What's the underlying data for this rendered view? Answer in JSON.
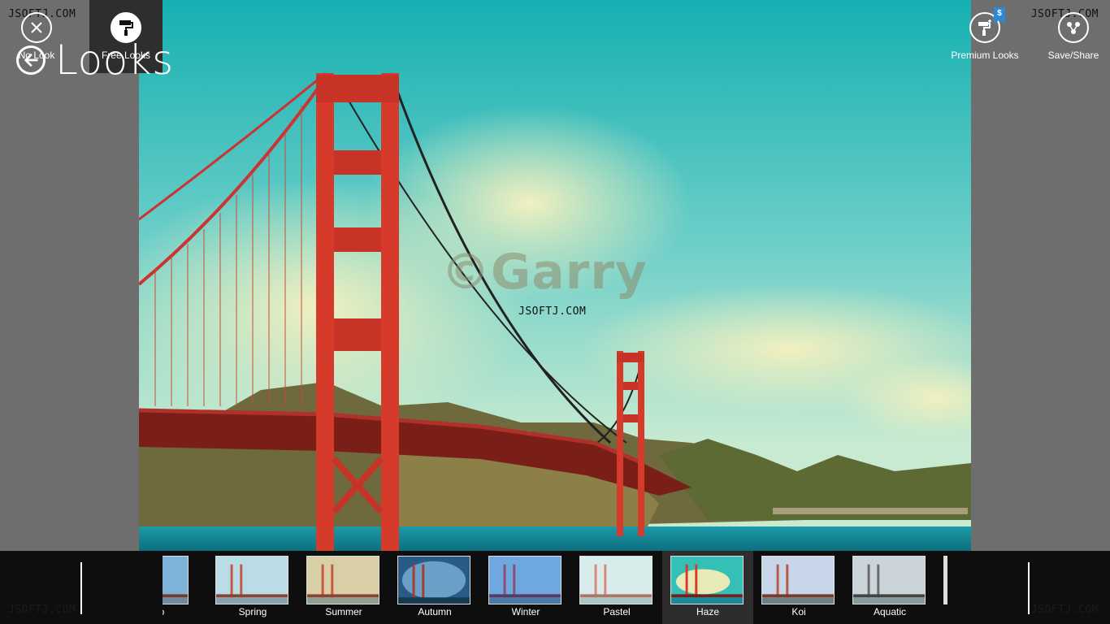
{
  "watermarks": {
    "top_left": "JSOFTJ.COM",
    "top_right": "JSOFTJ.COM",
    "center": "JSOFTJ.COM",
    "bottom_left": "JSOFTJ.COM",
    "bottom_right": "JSOFTJ.COM"
  },
  "header": {
    "title": "Looks",
    "back_icon": "back-arrow-icon"
  },
  "photo": {
    "subject": "golden-gate-bridge",
    "overlay_text": "©Garry",
    "colors": {
      "sky_top": "#18b3b3",
      "sky_bottom": "#bfe6cc",
      "bridge": "#d63a2a",
      "water": "#1a8a9a"
    }
  },
  "appbar": {
    "no_look": {
      "label": "No Look",
      "icon": "close-circle-icon"
    },
    "free_looks": {
      "label": "Free Looks",
      "icon": "paint-roller-icon"
    },
    "premium_looks": {
      "label": "Premium Looks",
      "icon": "paint-roller-plus-icon",
      "badge": "$"
    },
    "save_share": {
      "label": "Save/Share",
      "icon": "share-icon"
    },
    "looks": [
      {
        "label": "Neno",
        "tint": "#7fb2d8"
      },
      {
        "label": "Spring",
        "tint": "#b9dce7"
      },
      {
        "label": "Summer",
        "tint": "#d8cfa6"
      },
      {
        "label": "Autumn",
        "tint": "#2a5a86"
      },
      {
        "label": "Winter",
        "tint": "#6fa7e0"
      },
      {
        "label": "Pastel",
        "tint": "#d9ecec"
      },
      {
        "label": "Haze",
        "tint": "#35c0b7"
      },
      {
        "label": "Koi",
        "tint": "#c7d6ea"
      },
      {
        "label": "Aquatic",
        "tint": "#cbd4d8"
      }
    ],
    "selected_look": "Haze"
  }
}
